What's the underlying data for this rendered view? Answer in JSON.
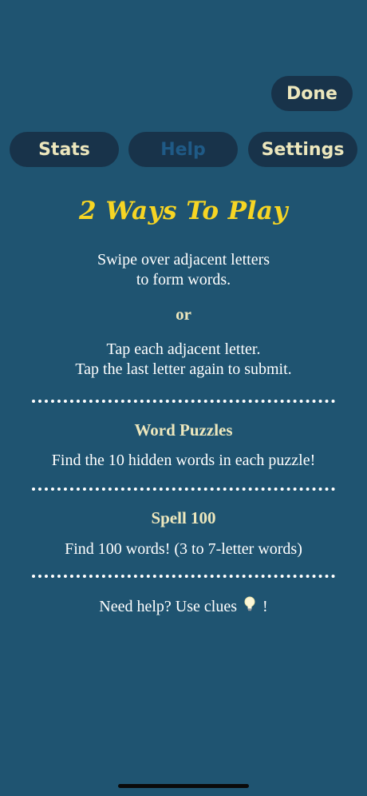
{
  "top": {
    "done_label": "Done"
  },
  "tabs": [
    {
      "label": "Stats"
    },
    {
      "label": "Help"
    },
    {
      "label": "Settings"
    }
  ],
  "help": {
    "title": "2 Ways To Play",
    "swipe_line1": "Swipe over adjacent letters",
    "swipe_line2": "to form words.",
    "or": "or",
    "tap_line1": "Tap each adjacent letter.",
    "tap_line2": "Tap the last letter again to submit.",
    "section1_title": "Word Puzzles",
    "section1_text": "Find the 10 hidden words in each puzzle!",
    "section2_title": "Spell 100",
    "section2_text": "Find 100 words! (3 to 7-letter words)",
    "clue_prefix": "Need help? Use clues",
    "clue_suffix": "!"
  },
  "colors": {
    "background": "#1f5471",
    "button_bg": "#18334a",
    "button_text": "#ece7bd",
    "active_tab_text": "#1f5a86",
    "title": "#f6d524"
  },
  "icons": {
    "clue": "lightbulb-icon"
  }
}
